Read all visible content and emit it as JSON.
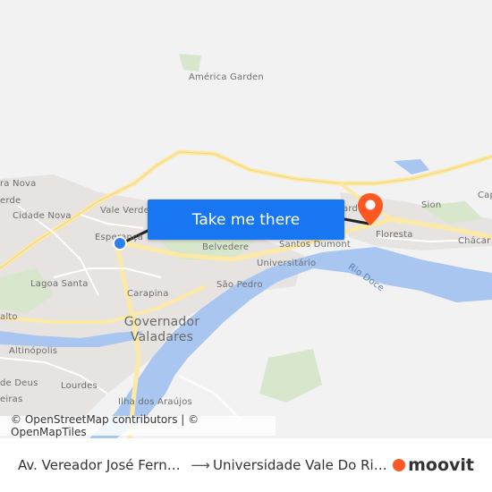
{
  "map": {
    "labels": {
      "america_garden": "América Garden",
      "vale_verde": "Vale Verde",
      "esperanca": "Esperança",
      "cidade_nova": "Cidade Nova",
      "ira_nova": "ra Nova",
      "verde": "erde",
      "lagoa_santa": "Lagoa Santa",
      "carapina": "Carapina",
      "belvedere": "Belvedere",
      "santos_dumont": "Santos Dumont",
      "universitario": "Universitário",
      "sao_pedro": "São Pedro",
      "governador_valadares": "Governador Valadares",
      "altinopolis": "Altinópolis",
      "lourdes": "Lourdes",
      "de_deus": "de Deus",
      "ilha_dos_araujos": "Ilha dos Araújos",
      "rio_doce": "Rio Doce",
      "floresta": "Floresta",
      "sion": "Sion",
      "chacar": "Chácar",
      "cap": "Cap",
      "nard": "ard",
      "salto": "alto",
      "eiras": "eiras"
    }
  },
  "cta": {
    "label": "Take me there"
  },
  "attribution": {
    "text": "© OpenStreetMap contributors | © OpenMapTiles"
  },
  "footer": {
    "origin": "Av. Vereador José Fernandes",
    "destination": "Universidade Vale Do Rio Doce",
    "arrow": "⟶",
    "brand": "moovit"
  },
  "colors": {
    "accent": "#1976f2",
    "origin_marker": "#2f7ef0",
    "dest_marker": "#ff5722",
    "river": "#a8c6f0",
    "road": "#fde9a6",
    "park": "#d8e6cc"
  }
}
